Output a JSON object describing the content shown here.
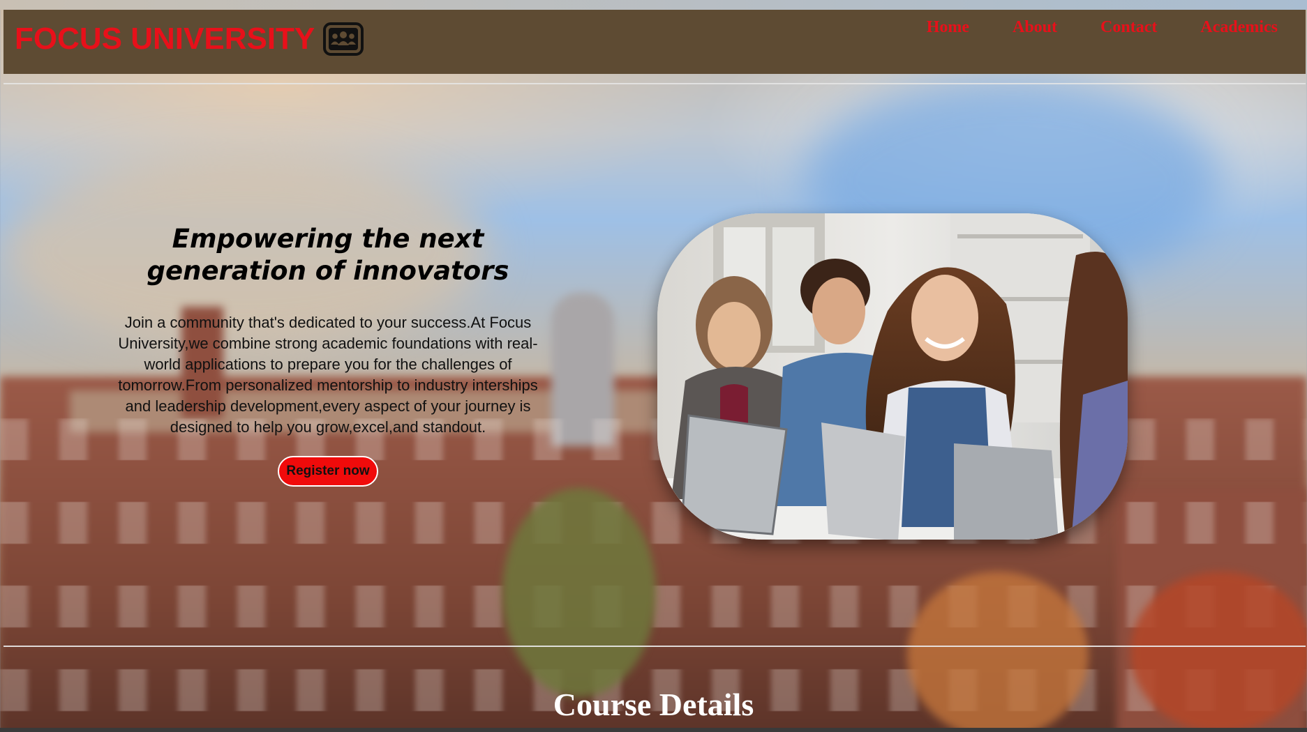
{
  "header": {
    "brand": "FOCUS UNIVERSITY",
    "brand_icon": "group-icon",
    "nav": [
      {
        "label": "Home"
      },
      {
        "label": "About"
      },
      {
        "label": "Contact"
      },
      {
        "label": "Academics"
      }
    ]
  },
  "hero": {
    "title": "Empowering the next generation of innovators",
    "body": "Join a community that's dedicated to your success.At Focus University,we combine strong academic foundations with real-world applications to prepare you for the challenges of tomorrow.From personalized mentorship to industry interships and leadership development,every aspect of your journey is designed to help you grow,excel,and standout.",
    "cta_label": "Register now",
    "image": "students-with-laptops-photo"
  },
  "course_section": {
    "title": "Course Details"
  },
  "colors": {
    "header_bg": "#5e4b33",
    "brand_red": "#e8101a",
    "cta_red": "#f00b0b"
  }
}
